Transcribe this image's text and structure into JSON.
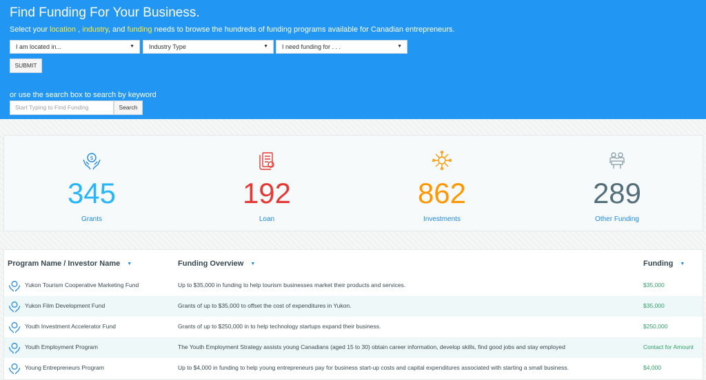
{
  "hero": {
    "title": "Find Funding For Your Business.",
    "sub_prefix": "Select your",
    "sub_location": "location",
    "sub_comma1": ",",
    "sub_industry": "industry",
    "sub_and": ", and",
    "sub_funding": "funding",
    "sub_suffix": "needs to browse the hundreds of funding programs available for Canadian entrepreneurs.",
    "accent_color": "#ffeb3b",
    "bg_color": "#2196f3"
  },
  "filters": {
    "location": "I am located in...",
    "industry": "Industry Type",
    "funding": "I need funding for . . .",
    "submit_label": "SUBMIT"
  },
  "search": {
    "prompt": "or use the search box to search by keyword",
    "placeholder": "Start Typing to Find Funding",
    "button_label": "Search"
  },
  "stats": [
    {
      "value": "345",
      "label": "Grants",
      "color": "#29b6f6",
      "label_color": "#1e88e5",
      "icon": "money-hands-icon"
    },
    {
      "value": "192",
      "label": "Loan",
      "color": "#e53935",
      "label_color": "#1e88e5",
      "icon": "loan-document-icon"
    },
    {
      "value": "862",
      "label": "Investments",
      "color": "#ff9800",
      "label_color": "#1e88e5",
      "icon": "investment-network-icon"
    },
    {
      "value": "289",
      "label": "Other Funding",
      "color": "#546e7a",
      "label_color": "#1e88e5",
      "icon": "meeting-people-icon"
    }
  ],
  "table": {
    "headers": {
      "name": "Program Name / Investor Name",
      "overview": "Funding Overview",
      "funding": "Funding"
    },
    "rows": [
      {
        "name": "Yukon Tourism Cooperative Marketing Fund",
        "overview": "Up to $35,000 in funding to help tourism businesses market their products and services.",
        "amount": "$35,000"
      },
      {
        "name": "Yukon Film Development Fund",
        "overview": "Grants of up to $35,000 to offset the cost of expenditures in Yukon.",
        "amount": "$35,000"
      },
      {
        "name": "Youth Investment Accelerator Fund",
        "overview": "Grants of up to $250,000 in to help technology startups expand their business.",
        "amount": "$250,000"
      },
      {
        "name": "Youth Employment Program",
        "overview": "The Youth Employment Strategy assists young Canadians (aged 15 to 30) obtain career information, develop skills, find good jobs and stay employed",
        "amount": "Contact for Amount"
      },
      {
        "name": "Young Entrepreneurs Program",
        "overview": "Up to $4,000 in funding to help young entrepreneurs pay for business start-up costs and capital expenditures associated with starting a small business.",
        "amount": "$4,000"
      }
    ]
  }
}
